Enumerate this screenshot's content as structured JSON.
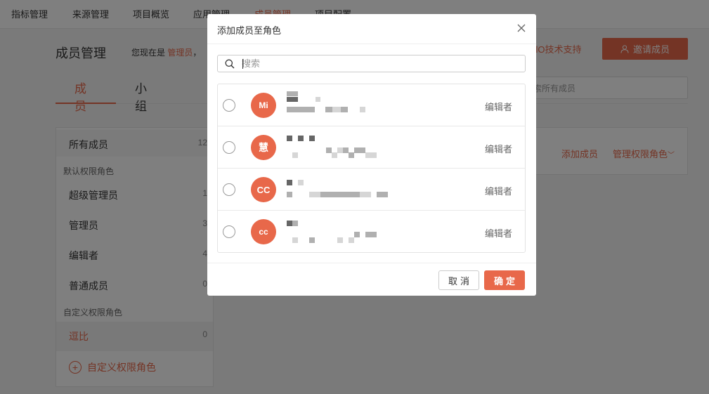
{
  "colors": {
    "accent": "#e8684a",
    "overlay": "rgba(0,0,0,0.5)"
  },
  "topnav": {
    "items": [
      {
        "label": "指标管理"
      },
      {
        "label": "来源管理"
      },
      {
        "label": "项目概览"
      },
      {
        "label": "应用管理"
      },
      {
        "label": "成员管理",
        "active": true
      },
      {
        "label": "项目配置"
      }
    ]
  },
  "page": {
    "title": "成员管理",
    "role_prefix": "您现在是",
    "role_name": "管理员",
    "role_suffix": "，",
    "support_link": "nglO技术支持",
    "invite_button": "邀请成员",
    "tabs": [
      {
        "label": "成员",
        "active": true
      },
      {
        "label": "小组"
      }
    ],
    "search_placeholder": "索所有成员"
  },
  "sidebar": {
    "all_members": {
      "label": "所有成员",
      "count": "12"
    },
    "default_group": "默认权限角色",
    "default_roles": [
      {
        "label": "超级管理员",
        "count": "1"
      },
      {
        "label": "管理员",
        "count": "3"
      },
      {
        "label": "编辑者",
        "count": "4"
      },
      {
        "label": "普通成员",
        "count": "0"
      }
    ],
    "custom_group": "自定义权限角色",
    "custom_roles": [
      {
        "label": "逗比",
        "count": "0",
        "active": true
      }
    ],
    "add_custom_label": "自定义权限角色"
  },
  "main_panel": {
    "add_member": "添加成员",
    "manage_roles": "管理权限角色"
  },
  "modal": {
    "title": "添加成员至角色",
    "search_placeholder": "搜索",
    "members": [
      {
        "avatar": "Mi",
        "role": "编辑者"
      },
      {
        "avatar": "慧",
        "role": "编辑者"
      },
      {
        "avatar": "CC",
        "role": "编辑者"
      },
      {
        "avatar": "cc",
        "role": "编辑者"
      }
    ],
    "cancel_label": "取消",
    "confirm_label": "确定"
  }
}
